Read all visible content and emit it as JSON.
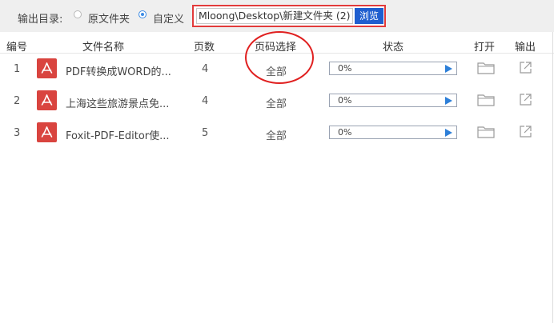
{
  "output": {
    "label": "输出目录:",
    "option_original": "原文件夹",
    "option_custom": "自定义",
    "path_value": "Mloong\\Desktop\\新建文件夹 (2)",
    "browse_label": "浏览"
  },
  "table": {
    "headers": {
      "num": "编号",
      "name": "文件名称",
      "pages": "页数",
      "range": "页码选择",
      "status": "状态",
      "open": "打开",
      "export": "输出"
    },
    "rows": [
      {
        "num": "1",
        "name": "PDF转换成WORD的...",
        "pages": "4",
        "range": "全部",
        "status": "0%"
      },
      {
        "num": "2",
        "name": "上海这些旅游景点免...",
        "pages": "4",
        "range": "全部",
        "status": "0%"
      },
      {
        "num": "3",
        "name": "Foxit-PDF-Editor使...",
        "pages": "5",
        "range": "全部",
        "status": "0%"
      }
    ]
  },
  "icons": {
    "file": "pdf-icon",
    "play": "play-icon",
    "open": "folder-icon",
    "export": "export-icon"
  },
  "colors": {
    "accent": "#1f5ecf",
    "highlight": "#e23a3a",
    "pdf": "#d9443f",
    "play": "#2d7fd8"
  }
}
